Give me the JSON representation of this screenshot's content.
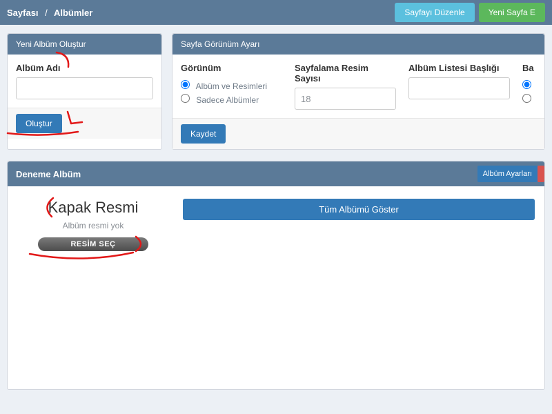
{
  "topbar": {
    "breadcrumb_part1": "Sayfası",
    "breadcrumb_part2": "Albümler",
    "edit_page": "Sayfayı Düzenle",
    "new_page": "Yeni Sayfa E"
  },
  "create_panel": {
    "header": "Yeni Albüm Oluştur",
    "name_label": "Albüm Adı",
    "name_value": "",
    "submit": "Oluştur"
  },
  "settings_panel": {
    "header": "Sayfa Görünüm Ayarı",
    "view_label": "Görünüm",
    "view_options": [
      {
        "label": "Albüm ve Resimleri",
        "checked": true
      },
      {
        "label": "Sadece Albümler",
        "checked": false
      }
    ],
    "page_count_label": "Sayfalama Resim Sayısı",
    "page_count_value": "18",
    "list_title_label": "Albüm Listesi Başlığı",
    "list_title_value": "",
    "extra_label": "Ba",
    "save": "Kaydet"
  },
  "album": {
    "title": "Deneme Albüm",
    "settings_btn": "Albüm Ayarları",
    "cover_title": "Kapak Resmi",
    "cover_note": "Albüm resmi yok",
    "select_image": "RESİM SEÇ",
    "show_all": "Tüm Albümü Göster"
  },
  "annotations": [
    "album-adi-pointer",
    "olustur-pointer",
    "kapak-resmi-pointer",
    "resim-sec-pointer"
  ]
}
